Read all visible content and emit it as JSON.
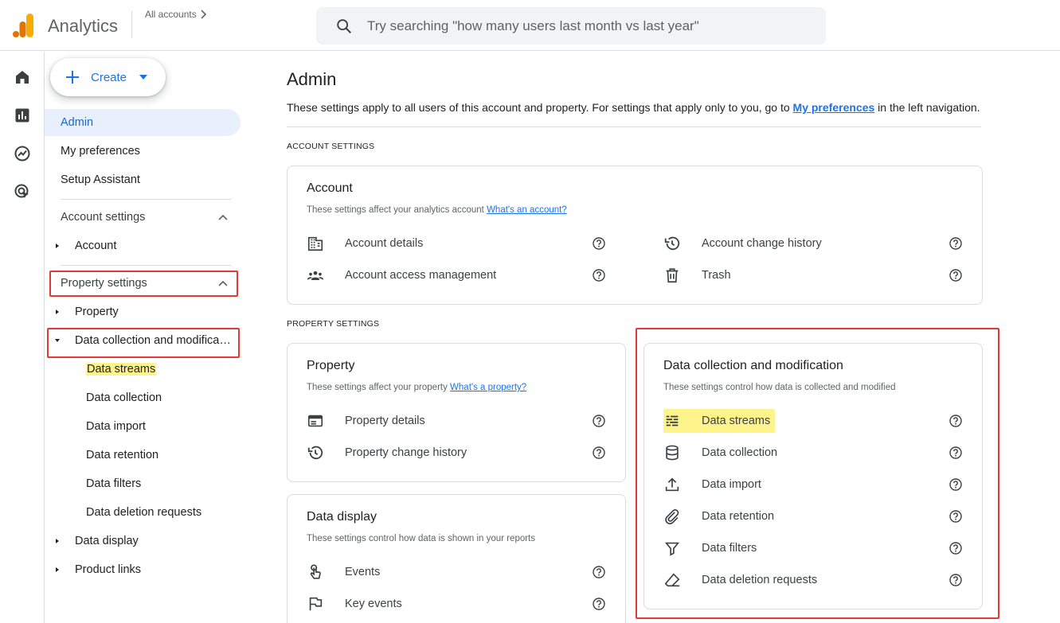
{
  "header": {
    "app_title": "Analytics",
    "accounts_link": "All accounts",
    "search_placeholder": "Try searching \"how many users last month vs last year\""
  },
  "rail": [
    "home-icon",
    "reports-icon",
    "explore-icon",
    "advertising-icon"
  ],
  "sidebar": {
    "create_label": "Create",
    "admin": "Admin",
    "my_preferences": "My preferences",
    "setup_assistant": "Setup Assistant",
    "account_settings": "Account settings",
    "account": "Account",
    "property_settings": "Property settings",
    "property": "Property",
    "data_collection_mod": "Data collection and modifica…",
    "sub_items": [
      "Data streams",
      "Data collection",
      "Data import",
      "Data retention",
      "Data filters",
      "Data deletion requests"
    ],
    "data_display": "Data display",
    "product_links": "Product links"
  },
  "main": {
    "title": "Admin",
    "desc_before": "These settings apply to all users of this account and property. For settings that apply only to you, go to ",
    "desc_link": "My preferences",
    "desc_after": " in the left navigation.",
    "account_section": "ACCOUNT SETTINGS",
    "property_section": "PROPERTY SETTINGS",
    "account_card": {
      "title": "Account",
      "sub": "These settings affect your analytics account ",
      "sub_link": "What's an account?",
      "rows": [
        "Account details",
        "Account change history",
        "Account access management",
        "Trash"
      ]
    },
    "property_card": {
      "title": "Property",
      "sub": "These settings affect your property ",
      "sub_link": "What's a property?",
      "rows": [
        "Property details",
        "Property change history"
      ]
    },
    "display_card": {
      "title": "Data display",
      "sub": "These settings control how data is shown in your reports",
      "rows": [
        "Events",
        "Key events"
      ]
    },
    "dcm_card": {
      "title": "Data collection and modification",
      "sub": "These settings control how data is collected and modified",
      "rows": [
        "Data streams",
        "Data collection",
        "Data import",
        "Data retention",
        "Data filters",
        "Data deletion requests"
      ]
    }
  },
  "colors": {
    "accent": "#1a73e8",
    "highlight": "#fef48b",
    "annotation_red": "#e53935",
    "logo_orange": "#f9ab00",
    "logo_dark": "#e37400"
  }
}
